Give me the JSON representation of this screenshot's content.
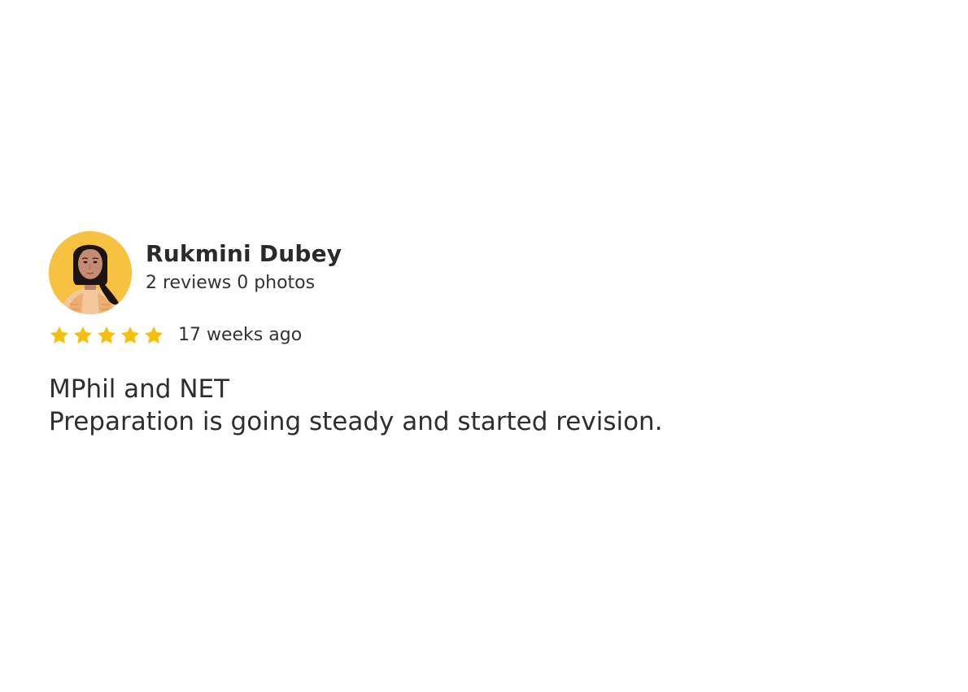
{
  "review": {
    "author_name": "Rukmini Dubey",
    "author_stats": "2 reviews 0 photos",
    "rating": 5,
    "max_rating": 5,
    "time_ago": "17 weeks ago",
    "text_lines": [
      "MPhil and NET",
      "Preparation is going steady and started revision."
    ],
    "avatar_icon": "profile-photo",
    "star_icon": "star-icon"
  },
  "colors": {
    "avatar_background": "#f7c242",
    "star": "#f5bf0e",
    "text": "#2b2b2b"
  }
}
